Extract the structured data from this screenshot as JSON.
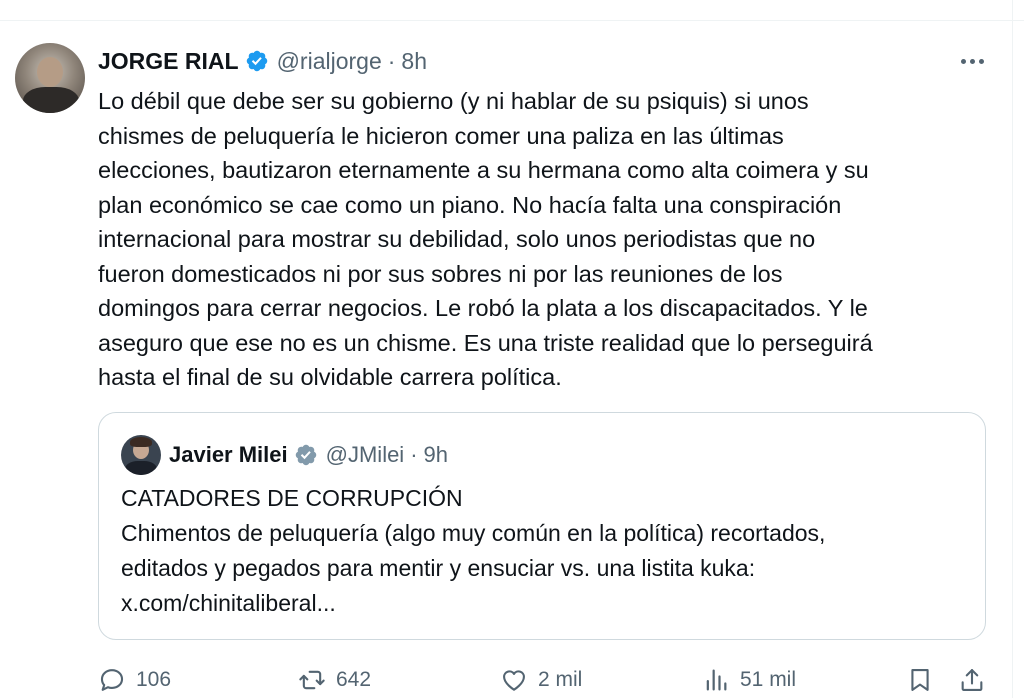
{
  "tweet": {
    "author_name": "JORGE RIAL",
    "handle": "@rialjorge",
    "separator": "·",
    "time": "8h",
    "text_lines": [
      "Lo débil que debe ser su gobierno (y ni hablar de su psiquis) si unos",
      "chismes de peluquería le hicieron comer una paliza en las últimas",
      "elecciones, bautizaron eternamente a su hermana como alta coimera y su",
      "plan económico se cae como un piano. No hacía falta una conspiración",
      "internacional para mostrar su debilidad, solo unos periodistas que no",
      "fueron domesticados ni por sus sobres ni por las reuniones de los",
      "domingos para cerrar negocios. Le robó la plata a los discapacitados. Y le",
      "aseguro que ese no es un chisme. Es una triste realidad que lo perseguirá",
      "hasta el final de su olvidable carrera política."
    ]
  },
  "quote": {
    "author_name": "Javier Milei",
    "handle": "@JMilei",
    "separator": "·",
    "time": "9h",
    "text_lines": [
      "CATADORES DE CORRUPCIÓN",
      "Chimentos de peluquería (algo muy común en la política) recortados,",
      "editados y pegados para mentir y ensuciar vs. una listita kuka:",
      "x.com/chinitaliberal..."
    ]
  },
  "actions": {
    "replies": "106",
    "reposts": "642",
    "likes": "2 mil",
    "views": "51 mil"
  },
  "icons": {
    "verified_blue": "verified-badge-icon",
    "verified_gray": "verified-badge-gray-icon",
    "more": "more-dots-icon",
    "reply": "reply-icon",
    "retweet": "retweet-icon",
    "like": "heart-icon",
    "views": "views-chart-icon",
    "bookmark": "bookmark-icon",
    "share": "share-icon"
  },
  "colors": {
    "verified_blue": "#1d9bf0",
    "verified_gray": "#829aab",
    "text": "#0f1419",
    "secondary": "#536471",
    "border": "#cfd9de"
  }
}
